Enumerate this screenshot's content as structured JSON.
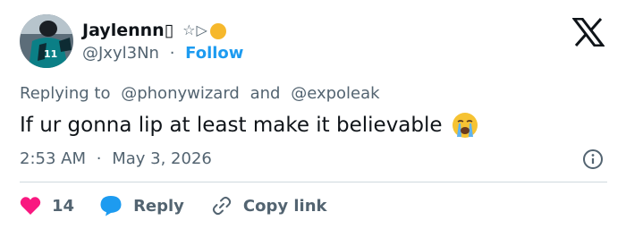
{
  "author": {
    "display_name": "Jaylennn▯",
    "name_emojis": "☆▷",
    "handle": "@Jxyl3Nn",
    "separator": "·",
    "follow_label": "Follow"
  },
  "reply_context": {
    "prefix": "Replying to",
    "mention_1": "@phonywizard",
    "conjunction": "and",
    "mention_2": "@expoleak"
  },
  "tweet": {
    "text": "If ur gonna lip at least make it believable",
    "time": "2:53 AM",
    "separator": "·",
    "date": "May 3, 2026"
  },
  "actions": {
    "like_count": "14",
    "reply_label": "Reply",
    "copy_label": "Copy link"
  },
  "colors": {
    "accent": "#1d9bf0",
    "like": "#f91880",
    "secondary_text": "#536471",
    "divider": "#cfd9de"
  },
  "icons": {
    "brand": "x-logo-icon",
    "info": "info-icon",
    "like": "heart-icon",
    "reply": "speech-bubble-icon",
    "copy": "link-icon",
    "emoji": "loudly-crying-face-icon"
  }
}
